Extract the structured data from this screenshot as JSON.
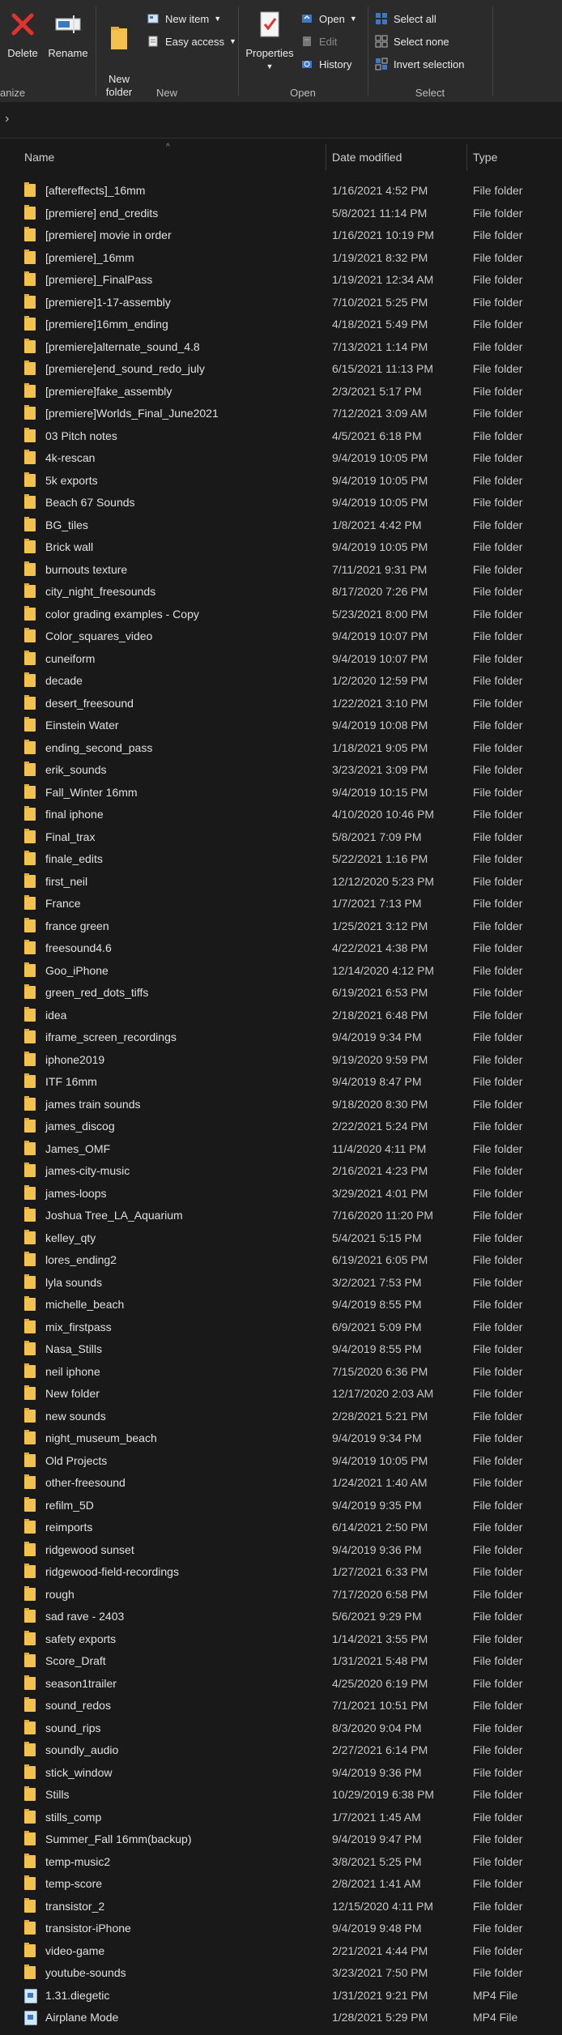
{
  "ribbon": {
    "organize": {
      "label": "anize",
      "delete": "Delete",
      "rename": "Rename"
    },
    "new": {
      "label": "New",
      "new_folder": "New\nfolder",
      "new_item": "New item",
      "easy_access": "Easy access"
    },
    "open": {
      "label": "Open",
      "properties": "Properties",
      "open": "Open",
      "edit": "Edit",
      "history": "History"
    },
    "select": {
      "label": "Select",
      "select_all": "Select all",
      "select_none": "Select none",
      "invert_selection": "Invert selection"
    }
  },
  "address_bar": {
    "chevron": "›"
  },
  "columns": {
    "name": "Name",
    "date_modified": "Date modified",
    "type": "Type"
  },
  "files": [
    {
      "name": "[aftereffects]_16mm",
      "date": "1/16/2021 4:52 PM",
      "type": "File folder",
      "icon": "folder-icon"
    },
    {
      "name": "[premiere] end_credits",
      "date": "5/8/2021 11:14 PM",
      "type": "File folder",
      "icon": "folder-icon"
    },
    {
      "name": "[premiere] movie in order",
      "date": "1/16/2021 10:19 PM",
      "type": "File folder",
      "icon": "folder-icon"
    },
    {
      "name": "[premiere]_16mm",
      "date": "1/19/2021 8:32 PM",
      "type": "File folder",
      "icon": "folder-icon"
    },
    {
      "name": "[premiere]_FinalPass",
      "date": "1/19/2021 12:34 AM",
      "type": "File folder",
      "icon": "folder-icon"
    },
    {
      "name": "[premiere]1-17-assembly",
      "date": "7/10/2021 5:25 PM",
      "type": "File folder",
      "icon": "folder-icon"
    },
    {
      "name": "[premiere]16mm_ending",
      "date": "4/18/2021 5:49 PM",
      "type": "File folder",
      "icon": "folder-icon"
    },
    {
      "name": "[premiere]alternate_sound_4.8",
      "date": "7/13/2021 1:14 PM",
      "type": "File folder",
      "icon": "folder-icon"
    },
    {
      "name": "[premiere]end_sound_redo_july",
      "date": "6/15/2021 11:13 PM",
      "type": "File folder",
      "icon": "folder-icon"
    },
    {
      "name": "[premiere]fake_assembly",
      "date": "2/3/2021 5:17 PM",
      "type": "File folder",
      "icon": "folder-icon"
    },
    {
      "name": "[premiere]Worlds_Final_June2021",
      "date": "7/12/2021 3:09 AM",
      "type": "File folder",
      "icon": "folder-icon"
    },
    {
      "name": "03 Pitch notes",
      "date": "4/5/2021 6:18 PM",
      "type": "File folder",
      "icon": "folder-icon"
    },
    {
      "name": "4k-rescan",
      "date": "9/4/2019 10:05 PM",
      "type": "File folder",
      "icon": "folder-icon"
    },
    {
      "name": "5k exports",
      "date": "9/4/2019 10:05 PM",
      "type": "File folder",
      "icon": "folder-icon"
    },
    {
      "name": "Beach 67 Sounds",
      "date": "9/4/2019 10:05 PM",
      "type": "File folder",
      "icon": "folder-icon"
    },
    {
      "name": "BG_tiles",
      "date": "1/8/2021 4:42 PM",
      "type": "File folder",
      "icon": "folder-icon"
    },
    {
      "name": "Brick wall",
      "date": "9/4/2019 10:05 PM",
      "type": "File folder",
      "icon": "folder-icon"
    },
    {
      "name": "burnouts texture",
      "date": "7/11/2021 9:31 PM",
      "type": "File folder",
      "icon": "folder-icon"
    },
    {
      "name": "city_night_freesounds",
      "date": "8/17/2020 7:26 PM",
      "type": "File folder",
      "icon": "folder-icon"
    },
    {
      "name": "color grading examples - Copy",
      "date": "5/23/2021 8:00 PM",
      "type": "File folder",
      "icon": "folder-icon"
    },
    {
      "name": "Color_squares_video",
      "date": "9/4/2019 10:07 PM",
      "type": "File folder",
      "icon": "folder-icon"
    },
    {
      "name": "cuneiform",
      "date": "9/4/2019 10:07 PM",
      "type": "File folder",
      "icon": "folder-icon"
    },
    {
      "name": "decade",
      "date": "1/2/2020 12:59 PM",
      "type": "File folder",
      "icon": "folder-icon"
    },
    {
      "name": "desert_freesound",
      "date": "1/22/2021 3:10 PM",
      "type": "File folder",
      "icon": "folder-icon"
    },
    {
      "name": "Einstein Water",
      "date": "9/4/2019 10:08 PM",
      "type": "File folder",
      "icon": "folder-icon"
    },
    {
      "name": "ending_second_pass",
      "date": "1/18/2021 9:05 PM",
      "type": "File folder",
      "icon": "folder-icon"
    },
    {
      "name": "erik_sounds",
      "date": "3/23/2021 3:09 PM",
      "type": "File folder",
      "icon": "folder-icon"
    },
    {
      "name": "Fall_Winter 16mm",
      "date": "9/4/2019 10:15 PM",
      "type": "File folder",
      "icon": "folder-icon"
    },
    {
      "name": "final iphone",
      "date": "4/10/2020 10:46 PM",
      "type": "File folder",
      "icon": "folder-icon"
    },
    {
      "name": "Final_trax",
      "date": "5/8/2021 7:09 PM",
      "type": "File folder",
      "icon": "folder-icon"
    },
    {
      "name": "finale_edits",
      "date": "5/22/2021 1:16 PM",
      "type": "File folder",
      "icon": "folder-icon"
    },
    {
      "name": "first_neil",
      "date": "12/12/2020 5:23 PM",
      "type": "File folder",
      "icon": "folder-icon"
    },
    {
      "name": "France",
      "date": "1/7/2021 7:13 PM",
      "type": "File folder",
      "icon": "folder-icon"
    },
    {
      "name": "france green",
      "date": "1/25/2021 3:12 PM",
      "type": "File folder",
      "icon": "folder-icon"
    },
    {
      "name": "freesound4.6",
      "date": "4/22/2021 4:38 PM",
      "type": "File folder",
      "icon": "folder-icon"
    },
    {
      "name": "Goo_iPhone",
      "date": "12/14/2020 4:12 PM",
      "type": "File folder",
      "icon": "folder-icon"
    },
    {
      "name": "green_red_dots_tiffs",
      "date": "6/19/2021 6:53 PM",
      "type": "File folder",
      "icon": "folder-icon"
    },
    {
      "name": "idea",
      "date": "2/18/2021 6:48 PM",
      "type": "File folder",
      "icon": "folder-icon"
    },
    {
      "name": "iframe_screen_recordings",
      "date": "9/4/2019 9:34 PM",
      "type": "File folder",
      "icon": "folder-icon"
    },
    {
      "name": "iphone2019",
      "date": "9/19/2020 9:59 PM",
      "type": "File folder",
      "icon": "folder-icon"
    },
    {
      "name": "ITF 16mm",
      "date": "9/4/2019 8:47 PM",
      "type": "File folder",
      "icon": "folder-icon"
    },
    {
      "name": "james train sounds",
      "date": "9/18/2020 8:30 PM",
      "type": "File folder",
      "icon": "folder-icon"
    },
    {
      "name": "james_discog",
      "date": "2/22/2021 5:24 PM",
      "type": "File folder",
      "icon": "folder-icon"
    },
    {
      "name": "James_OMF",
      "date": "11/4/2020 4:11 PM",
      "type": "File folder",
      "icon": "folder-icon"
    },
    {
      "name": "james-city-music",
      "date": "2/16/2021 4:23 PM",
      "type": "File folder",
      "icon": "folder-icon"
    },
    {
      "name": "james-loops",
      "date": "3/29/2021 4:01 PM",
      "type": "File folder",
      "icon": "folder-icon"
    },
    {
      "name": "Joshua Tree_LA_Aquarium",
      "date": "7/16/2020 11:20 PM",
      "type": "File folder",
      "icon": "folder-icon"
    },
    {
      "name": "kelley_qty",
      "date": "5/4/2021 5:15 PM",
      "type": "File folder",
      "icon": "folder-icon"
    },
    {
      "name": "lores_ending2",
      "date": "6/19/2021 6:05 PM",
      "type": "File folder",
      "icon": "folder-icon"
    },
    {
      "name": "lyla sounds",
      "date": "3/2/2021 7:53 PM",
      "type": "File folder",
      "icon": "folder-icon"
    },
    {
      "name": "michelle_beach",
      "date": "9/4/2019 8:55 PM",
      "type": "File folder",
      "icon": "folder-icon"
    },
    {
      "name": "mix_firstpass",
      "date": "6/9/2021 5:09 PM",
      "type": "File folder",
      "icon": "folder-icon"
    },
    {
      "name": "Nasa_Stills",
      "date": "9/4/2019 8:55 PM",
      "type": "File folder",
      "icon": "folder-icon"
    },
    {
      "name": "neil iphone",
      "date": "7/15/2020 6:36 PM",
      "type": "File folder",
      "icon": "folder-icon"
    },
    {
      "name": "New folder",
      "date": "12/17/2020 2:03 AM",
      "type": "File folder",
      "icon": "folder-icon"
    },
    {
      "name": "new sounds",
      "date": "2/28/2021 5:21 PM",
      "type": "File folder",
      "icon": "folder-icon"
    },
    {
      "name": "night_museum_beach",
      "date": "9/4/2019 9:34 PM",
      "type": "File folder",
      "icon": "folder-icon"
    },
    {
      "name": "Old Projects",
      "date": "9/4/2019 10:05 PM",
      "type": "File folder",
      "icon": "folder-icon"
    },
    {
      "name": "other-freesound",
      "date": "1/24/2021 1:40 AM",
      "type": "File folder",
      "icon": "folder-icon"
    },
    {
      "name": "refilm_5D",
      "date": "9/4/2019 9:35 PM",
      "type": "File folder",
      "icon": "folder-icon"
    },
    {
      "name": "reimports",
      "date": "6/14/2021 2:50 PM",
      "type": "File folder",
      "icon": "folder-icon"
    },
    {
      "name": "ridgewood sunset",
      "date": "9/4/2019 9:36 PM",
      "type": "File folder",
      "icon": "folder-icon"
    },
    {
      "name": "ridgewood-field-recordings",
      "date": "1/27/2021 6:33 PM",
      "type": "File folder",
      "icon": "folder-icon"
    },
    {
      "name": "rough",
      "date": "7/17/2020 6:58 PM",
      "type": "File folder",
      "icon": "folder-icon"
    },
    {
      "name": "sad rave - 2403",
      "date": "5/6/2021 9:29 PM",
      "type": "File folder",
      "icon": "folder-icon"
    },
    {
      "name": "safety exports",
      "date": "1/14/2021 3:55 PM",
      "type": "File folder",
      "icon": "folder-icon"
    },
    {
      "name": "Score_Draft",
      "date": "1/31/2021 5:48 PM",
      "type": "File folder",
      "icon": "folder-icon"
    },
    {
      "name": "season1trailer",
      "date": "4/25/2020 6:19 PM",
      "type": "File folder",
      "icon": "folder-icon"
    },
    {
      "name": "sound_redos",
      "date": "7/1/2021 10:51 PM",
      "type": "File folder",
      "icon": "folder-icon"
    },
    {
      "name": "sound_rips",
      "date": "8/3/2020 9:04 PM",
      "type": "File folder",
      "icon": "folder-icon"
    },
    {
      "name": "soundly_audio",
      "date": "2/27/2021 6:14 PM",
      "type": "File folder",
      "icon": "folder-icon"
    },
    {
      "name": "stick_window",
      "date": "9/4/2019 9:36 PM",
      "type": "File folder",
      "icon": "folder-icon"
    },
    {
      "name": "Stills",
      "date": "10/29/2019 6:38 PM",
      "type": "File folder",
      "icon": "folder-icon"
    },
    {
      "name": "stills_comp",
      "date": "1/7/2021 1:45 AM",
      "type": "File folder",
      "icon": "folder-icon"
    },
    {
      "name": "Summer_Fall 16mm(backup)",
      "date": "9/4/2019 9:47 PM",
      "type": "File folder",
      "icon": "folder-icon"
    },
    {
      "name": "temp-music2",
      "date": "3/8/2021 5:25 PM",
      "type": "File folder",
      "icon": "folder-icon"
    },
    {
      "name": "temp-score",
      "date": "2/8/2021 1:41 AM",
      "type": "File folder",
      "icon": "folder-icon"
    },
    {
      "name": "transistor_2",
      "date": "12/15/2020 4:11 PM",
      "type": "File folder",
      "icon": "folder-icon"
    },
    {
      "name": "transistor-iPhone",
      "date": "9/4/2019 9:48 PM",
      "type": "File folder",
      "icon": "folder-icon"
    },
    {
      "name": "video-game",
      "date": "2/21/2021 4:44 PM",
      "type": "File folder",
      "icon": "folder-icon"
    },
    {
      "name": "youtube-sounds",
      "date": "3/23/2021 7:50 PM",
      "type": "File folder",
      "icon": "folder-icon"
    },
    {
      "name": "1.31.diegetic",
      "date": "1/31/2021 9:21 PM",
      "type": "MP4 File",
      "icon": "mp4-file-icon"
    },
    {
      "name": "Airplane Mode",
      "date": "1/28/2021 5:29 PM",
      "type": "MP4 File",
      "icon": "mp4-file-icon"
    }
  ]
}
